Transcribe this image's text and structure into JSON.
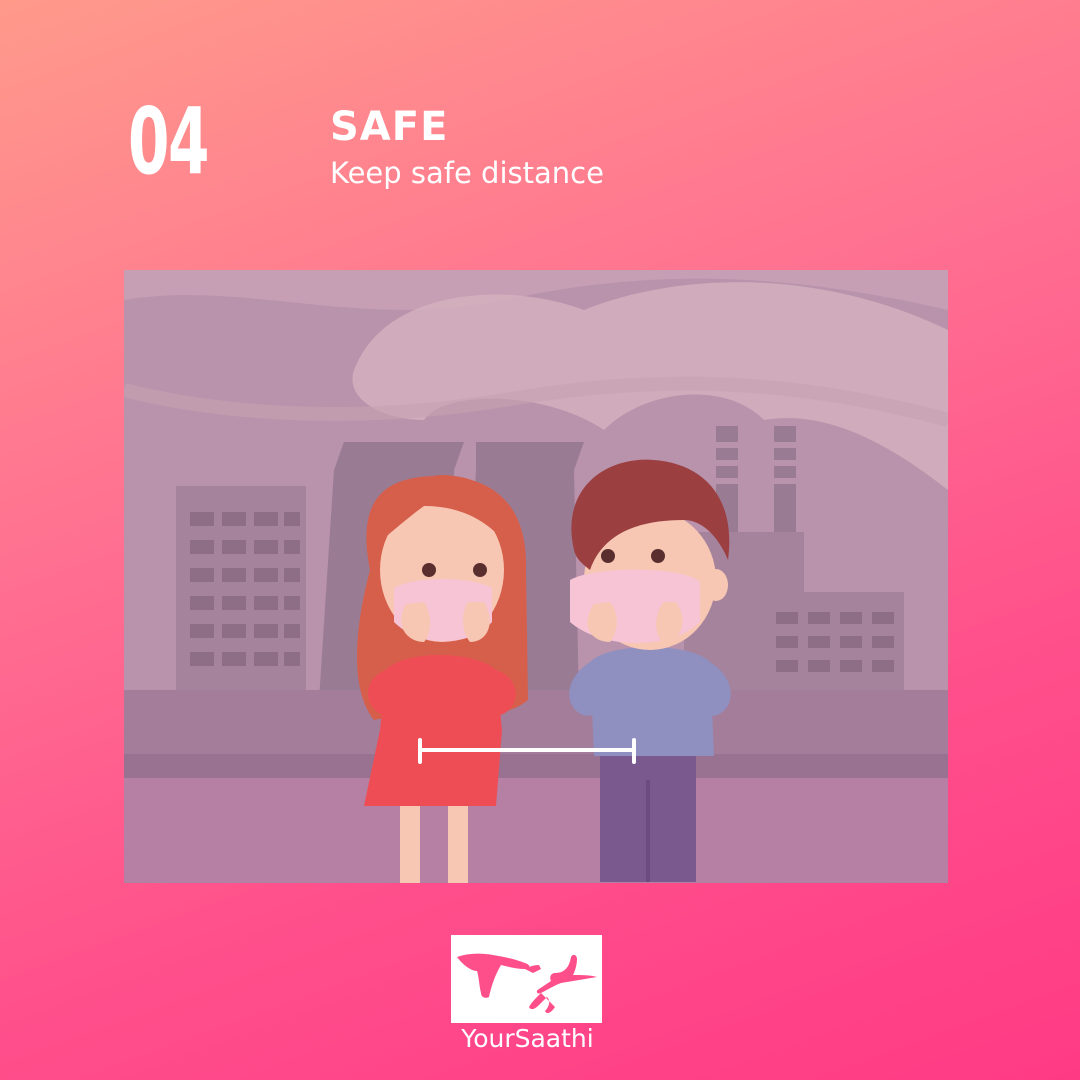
{
  "header": {
    "step_number": "04",
    "title": "SAFE",
    "subtitle": "Keep safe distance"
  },
  "illustration": {
    "scene": "two-children-wearing-masks-at-safe-distance",
    "colors": {
      "sky": "#b893ab",
      "building": "#9f7d98",
      "ground": "#b580a3",
      "girl_dress": "#ef4d55",
      "girl_hair": "#d65f4b",
      "boy_shirt": "#8f8fc0",
      "boy_pants": "#7a5a8e",
      "boy_hair": "#9b3f41",
      "mask": "#f7c4d6",
      "skin": "#f7c7b3"
    }
  },
  "brand": {
    "name": "YourSaathi",
    "logo_icon": "helping-hands-icon",
    "logo_color": "#ff4f8b"
  }
}
